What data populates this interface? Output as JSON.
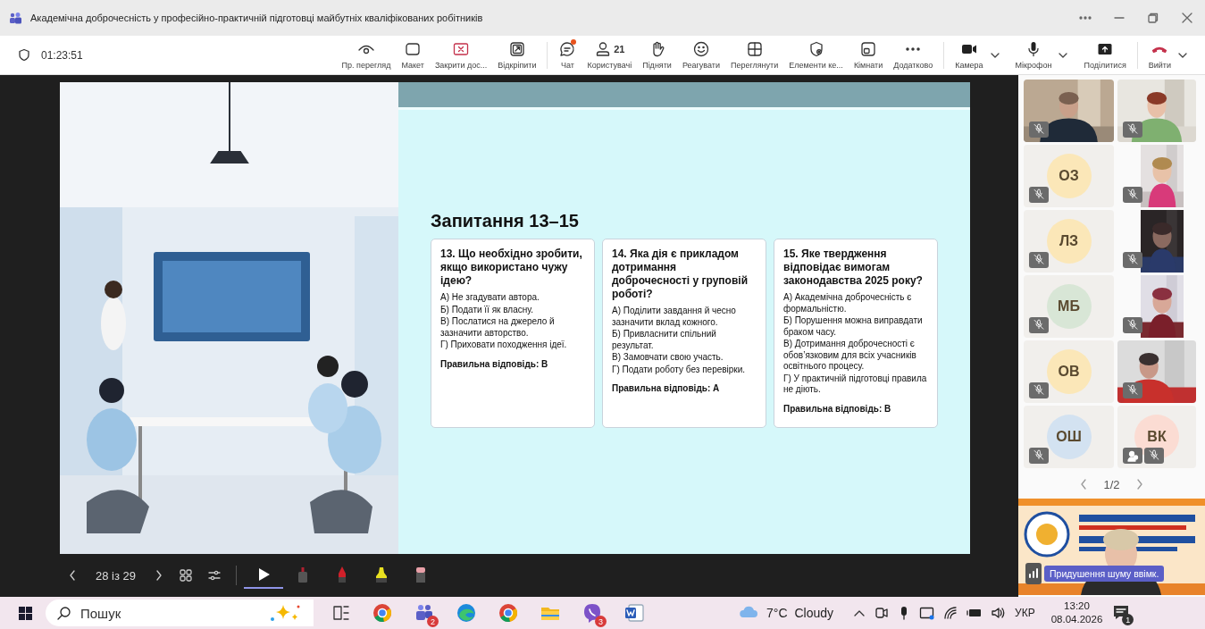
{
  "window": {
    "title": "Академічна доброчесність у професійно-практичній підготовці майбутніх кваліфікованих робітників"
  },
  "meeting_toolbar": {
    "timer": "01:23:51",
    "groups": [
      {
        "buttons": [
          {
            "kind": "view",
            "label": "Пр. перегляд"
          },
          {
            "kind": "layout",
            "label": "Макет"
          },
          {
            "kind": "stop",
            "label": "Закрити дос..."
          },
          {
            "kind": "unpin",
            "label": "Відкріпити"
          }
        ]
      },
      {
        "buttons": [
          {
            "kind": "chat",
            "label": "Чат",
            "unread": true
          },
          {
            "kind": "people",
            "label": "Користувачі",
            "count": "21"
          },
          {
            "kind": "hand",
            "label": "Підняти"
          },
          {
            "kind": "react",
            "label": "Реагувати"
          },
          {
            "kind": "grid",
            "label": "Переглянути"
          },
          {
            "kind": "apps",
            "label": "Елементи ке..."
          },
          {
            "kind": "rooms",
            "label": "Кімнати"
          },
          {
            "kind": "more",
            "label": "Додатково"
          }
        ]
      },
      {
        "buttons": [
          {
            "kind": "camera",
            "label": "Камера",
            "dropdown": true
          },
          {
            "kind": "mic",
            "label": "Мікрофон",
            "dropdown": true
          },
          {
            "kind": "share",
            "label": "Поділитися"
          }
        ]
      },
      {
        "buttons": [
          {
            "kind": "leave",
            "label": "Вийти",
            "dropdown": true
          }
        ]
      }
    ]
  },
  "slide": {
    "title": "Запитання 13–15",
    "cards": [
      {
        "question": "13. Що необхідно  зробити, якщо використано чужу ідею?",
        "options": [
          "А) Не згадувати автора.",
          "Б) Подати її як власну.",
          "В) Послатися на джерело й зазначити авторство.",
          "Г) Приховати походження ідеї."
        ],
        "answer": "Правильна відповідь: В"
      },
      {
        "question": "14. Яка дія є прикладом дотримання доброчесності у груповій роботі?",
        "options": [
          "А) Поділити завдання й чесно зазначити вклад кожного.",
          "Б) Привласнити спільний результат.",
          "В) Замовчати свою участь.",
          "Г) Подати роботу без перевірки."
        ],
        "answer": "Правильна відповідь: А"
      },
      {
        "question": "15. Яке твердження відповідає вимогам законодавства 2025 року?",
        "options": [
          "А) Академічна доброчесність є формальністю.",
          "Б) Порушення можна виправдати браком часу.",
          "В) Дотримання доброчесності є обов’язковим для всіх учасників освітнього процесу.",
          "Г) У практичній підготовці правила не діють."
        ],
        "answer": "Правильна відповідь: В"
      }
    ]
  },
  "presenter_bar": {
    "page": "28 із 29",
    "tools": [
      {
        "kind": "pointer",
        "selected": true
      },
      {
        "kind": "laser",
        "selected": false
      },
      {
        "kind": "pen",
        "selected": false
      },
      {
        "kind": "highlighter",
        "selected": false
      },
      {
        "kind": "eraser",
        "selected": false
      }
    ]
  },
  "participants": {
    "tiles": [
      {
        "kind": "video",
        "muted": true
      },
      {
        "kind": "video",
        "muted": true
      },
      {
        "kind": "avatar",
        "initials": "ОЗ",
        "color": "#fbe7b8",
        "muted": true
      },
      {
        "kind": "portrait",
        "muted": true
      },
      {
        "kind": "avatar",
        "initials": "ЛЗ",
        "color": "#fbe7b8",
        "muted": true
      },
      {
        "kind": "portrait",
        "muted": true
      },
      {
        "kind": "avatar",
        "initials": "МБ",
        "color": "#d8e6d6",
        "muted": true
      },
      {
        "kind": "portrait",
        "muted": true
      },
      {
        "kind": "avatar",
        "initials": "ОВ",
        "color": "#fbe7b8",
        "muted": true
      },
      {
        "kind": "video",
        "muted": true
      },
      {
        "kind": "avatar",
        "initials": "ОШ",
        "color": "#d3e2f1",
        "muted": true
      },
      {
        "kind": "avatar",
        "initials": "ВК",
        "color": "#fbdcd3",
        "muted": true,
        "in_room": true
      }
    ],
    "pager": "1/2",
    "presenter": {
      "noise_status": "Придушення шуму ввімк."
    }
  },
  "taskbar": {
    "search": {
      "placeholder": "Пошук"
    },
    "apps": [
      {
        "kind": "chrome"
      },
      {
        "kind": "teams",
        "badge": "2"
      },
      {
        "kind": "edge"
      },
      {
        "kind": "chrome"
      },
      {
        "kind": "files"
      },
      {
        "kind": "viber",
        "badge": "3"
      },
      {
        "kind": "word"
      }
    ],
    "weather": {
      "temperature": "7°C",
      "condition": "Cloudy"
    },
    "language": "УКР",
    "time": "13:20",
    "date": "08.04.2026",
    "notifications": "1"
  }
}
